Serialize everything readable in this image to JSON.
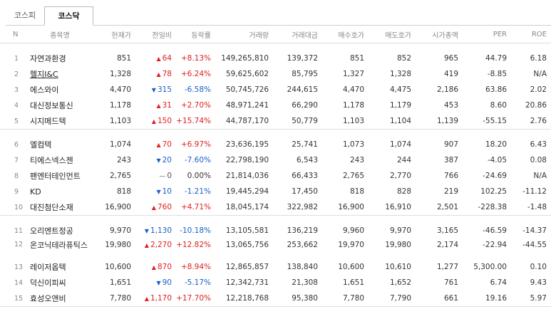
{
  "tabs": [
    {
      "label": "코스피",
      "active": false
    },
    {
      "label": "코스닥",
      "active": true
    }
  ],
  "columns": [
    "N",
    "종목명",
    "현재가",
    "전일비",
    "등락률",
    "거래량",
    "거래대금",
    "매수호가",
    "매도호가",
    "시가총액",
    "PER",
    "ROE"
  ],
  "colors": {
    "up": "#e02020",
    "down": "#1a5fc8"
  },
  "rows": [
    {
      "n": "1",
      "name": "자연과환경",
      "price": "851",
      "dir": "up",
      "change": "64",
      "rate": "+8.13%",
      "volume": "149,265,810",
      "amount": "139,372",
      "bid": "851",
      "ask": "852",
      "cap": "965",
      "per": "44.79",
      "roe": "6.18"
    },
    {
      "n": "2",
      "name": "헬지I&C",
      "price": "1,328",
      "dir": "up",
      "change": "78",
      "rate": "+6.24%",
      "volume": "59,625,602",
      "amount": "85,795",
      "bid": "1,327",
      "ask": "1,328",
      "cap": "419",
      "per": "-8.85",
      "roe": "N/A",
      "underline": true
    },
    {
      "n": "3",
      "name": "에스와이",
      "price": "4,470",
      "dir": "down",
      "change": "315",
      "rate": "-6.58%",
      "volume": "50,745,726",
      "amount": "244,615",
      "bid": "4,470",
      "ask": "4,475",
      "cap": "2,186",
      "per": "63.86",
      "roe": "2.02"
    },
    {
      "n": "4",
      "name": "대신정보통신",
      "price": "1,178",
      "dir": "up",
      "change": "31",
      "rate": "+2.70%",
      "volume": "48,971,241",
      "amount": "66,290",
      "bid": "1,178",
      "ask": "1,179",
      "cap": "453",
      "per": "8.60",
      "roe": "20.86"
    },
    {
      "n": "5",
      "name": "시지메드텍",
      "price": "1,103",
      "dir": "up",
      "change": "150",
      "rate": "+15.74%",
      "volume": "44,787,170",
      "amount": "50,779",
      "bid": "1,103",
      "ask": "1,104",
      "cap": "1,139",
      "per": "-55.15",
      "roe": "2.76"
    },
    {
      "n": "6",
      "name": "엘컴텍",
      "price": "1,074",
      "dir": "up",
      "change": "70",
      "rate": "+6.97%",
      "volume": "23,636,195",
      "amount": "25,741",
      "bid": "1,073",
      "ask": "1,074",
      "cap": "907",
      "per": "18.20",
      "roe": "6.43"
    },
    {
      "n": "7",
      "name": "티에스넥스젠",
      "price": "243",
      "dir": "down",
      "change": "20",
      "rate": "-7.60%",
      "volume": "22,798,190",
      "amount": "6,543",
      "bid": "243",
      "ask": "244",
      "cap": "387",
      "per": "-4.05",
      "roe": "0.08"
    },
    {
      "n": "8",
      "name": "팬엔터테인먼트",
      "price": "2,765",
      "dir": "flat",
      "change": "0",
      "rate": "0.00%",
      "volume": "21,814,036",
      "amount": "66,433",
      "bid": "2,765",
      "ask": "2,770",
      "cap": "766",
      "per": "-24.69",
      "roe": "N/A"
    },
    {
      "n": "9",
      "name": "KD",
      "price": "818",
      "dir": "down",
      "change": "10",
      "rate": "-1.21%",
      "volume": "19,445,294",
      "amount": "17,450",
      "bid": "818",
      "ask": "828",
      "cap": "219",
      "per": "102.25",
      "roe": "-11.12"
    },
    {
      "n": "10",
      "name": "대진첨단소재",
      "price": "16,900",
      "dir": "up",
      "change": "760",
      "rate": "+4.71%",
      "volume": "18,045,174",
      "amount": "322,982",
      "bid": "16,900",
      "ask": "16,910",
      "cap": "2,501",
      "per": "-228.38",
      "roe": "-1.48"
    },
    {
      "n": "11",
      "name": "오리엔트정공",
      "price": "9,970",
      "dir": "down",
      "change": "1,130",
      "rate": "-10.18%",
      "volume": "13,105,581",
      "amount": "136,219",
      "bid": "9,960",
      "ask": "9,970",
      "cap": "3,165",
      "per": "-46.59",
      "roe": "-14.37"
    },
    {
      "n": "12",
      "name": "온코닉테라퓨틱스",
      "price": "19,980",
      "dir": "up",
      "change": "2,270",
      "rate": "+12.82%",
      "volume": "13,065,756",
      "amount": "253,662",
      "bid": "19,970",
      "ask": "19,980",
      "cap": "2,174",
      "per": "-22.94",
      "roe": "-44.55",
      "tall": true
    },
    {
      "n": "13",
      "name": "레이저옵텍",
      "price": "10,600",
      "dir": "up",
      "change": "870",
      "rate": "+8.94%",
      "volume": "12,865,857",
      "amount": "138,840",
      "bid": "10,600",
      "ask": "10,610",
      "cap": "1,277",
      "per": "5,300.00",
      "roe": "0.10"
    },
    {
      "n": "14",
      "name": "덕신이피씨",
      "price": "1,651",
      "dir": "down",
      "change": "90",
      "rate": "-5.17%",
      "volume": "12,342,731",
      "amount": "21,308",
      "bid": "1,651",
      "ask": "1,652",
      "cap": "761",
      "per": "6.74",
      "roe": "9.43"
    },
    {
      "n": "15",
      "name": "효성오앤비",
      "price": "7,780",
      "dir": "up",
      "change": "1,170",
      "rate": "+17.70%",
      "volume": "12,218,768",
      "amount": "95,380",
      "bid": "7,780",
      "ask": "7,790",
      "cap": "661",
      "per": "19.16",
      "roe": "5.97"
    }
  ]
}
